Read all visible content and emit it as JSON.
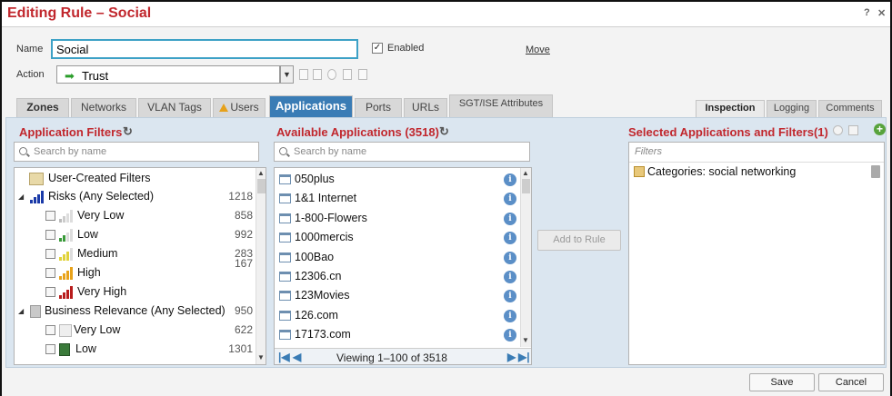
{
  "window": {
    "title": "Editing Rule – Social",
    "help": "?",
    "close": "✕"
  },
  "form": {
    "name_label": "Name",
    "name_value": "Social",
    "enabled_label": "Enabled",
    "enabled_check": "✓",
    "move_label": "Move",
    "action_label": "Action",
    "action_value": "Trust",
    "action_dropdown": "▼"
  },
  "tabs": [
    "Zones",
    "Networks",
    "VLAN Tags",
    "Users",
    "Applications",
    "Ports",
    "URLs",
    "SGT/ISE Attributes"
  ],
  "right_tabs": [
    "Inspection",
    "Logging",
    "Comments"
  ],
  "filters_panel": {
    "title": "Application Filters",
    "search_placeholder": "Search by name",
    "items": [
      {
        "label": "User-Created Filters",
        "count": ""
      },
      {
        "label": "Risks (Any Selected)",
        "count": "1218"
      },
      {
        "label": "Very Low",
        "count": "858"
      },
      {
        "label": "Low",
        "count": "992"
      },
      {
        "label": "Medium",
        "count": "283"
      },
      {
        "label": "High",
        "count": "167"
      },
      {
        "label": "Very High",
        "count": ""
      },
      {
        "label": "Business Relevance (Any Selected)",
        "count": "950"
      },
      {
        "label": "Very Low",
        "count": "622"
      },
      {
        "label": "Low",
        "count": "1301"
      }
    ]
  },
  "apps_panel": {
    "title": "Available Applications (3518)",
    "search_placeholder": "Search by name",
    "items": [
      "050plus",
      "1&1 Internet",
      "1-800-Flowers",
      "1000mercis",
      "100Bao",
      "12306.cn",
      "123Movies",
      "126.com",
      "17173.com"
    ],
    "info_glyph": "i",
    "pager_text": "Viewing 1–100 of 3518"
  },
  "add_button": "Add to Rule",
  "selected_panel": {
    "title": "Selected Applications and Filters(1)",
    "filter_placeholder": "Filters",
    "item": "Categories: social networking",
    "add_glyph": "+"
  },
  "footer": {
    "save": "Save",
    "cancel": "Cancel"
  },
  "colors": {
    "accent": "#c1272d",
    "active_tab": "#3a7cb5",
    "panel_bg": "#dbe6f0"
  }
}
